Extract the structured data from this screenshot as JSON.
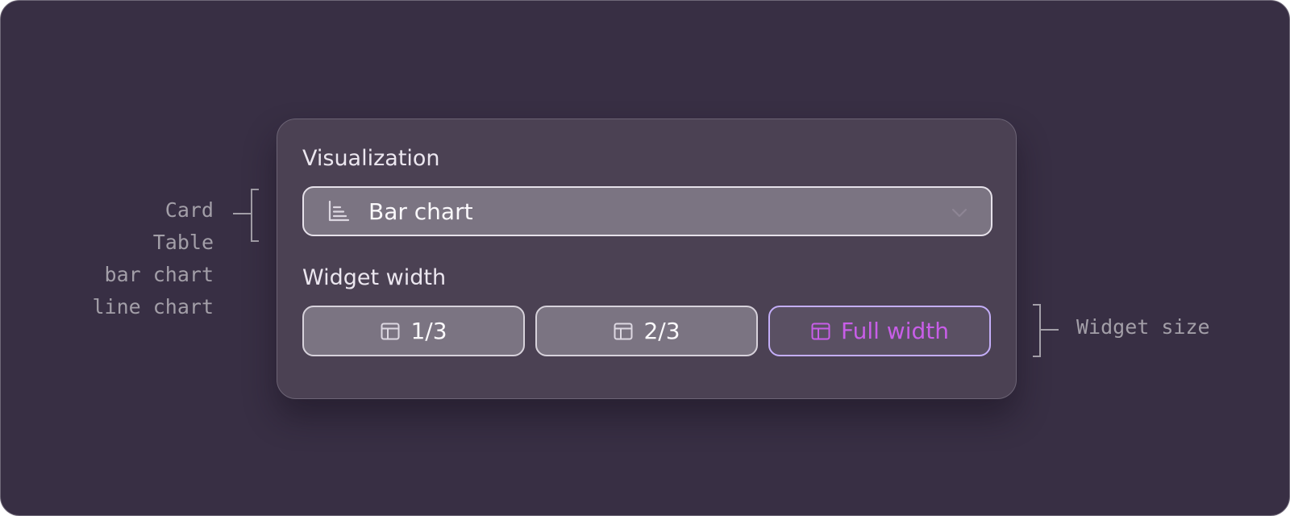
{
  "options_list": [
    "Card",
    "Table",
    "bar chart",
    "line chart"
  ],
  "annotation": {
    "widget_size_label": "Widget size"
  },
  "panel": {
    "visualization_label": "Visualization",
    "visualization_select": {
      "value": "Bar chart",
      "icon": "bar-chart-icon",
      "chevron_icon": "chevron-down-icon"
    },
    "width_label": "Widget width",
    "width_options": [
      {
        "label": "1/3",
        "icon": "layout-icon",
        "selected": false
      },
      {
        "label": "2/3",
        "icon": "layout-icon",
        "selected": false
      },
      {
        "label": "Full width",
        "icon": "layout-icon",
        "selected": true
      }
    ]
  },
  "colors": {
    "background": "#382f44",
    "panel": "#4b4153",
    "control": "#7b7482",
    "selected_text": "#c85ee8",
    "selected_border": "#c4aef9",
    "annotation_text": "#a39fa8"
  }
}
